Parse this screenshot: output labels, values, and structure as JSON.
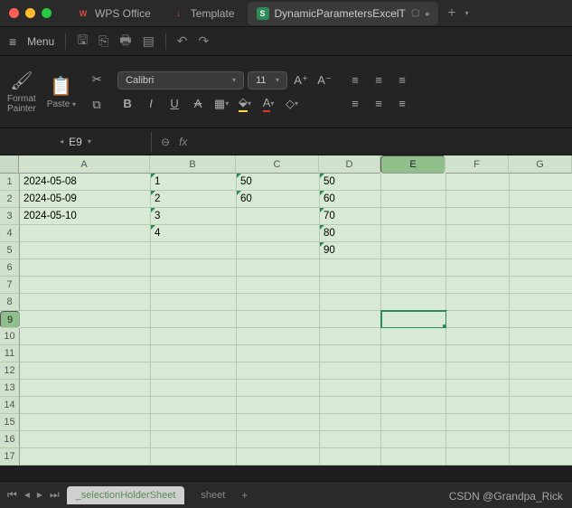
{
  "window": {
    "tabs": [
      {
        "icon": "W",
        "label": "WPS Office"
      },
      {
        "icon": "↓",
        "label": "Template"
      },
      {
        "icon": "S",
        "label": "DynamicParametersExcelT"
      }
    ],
    "menu_label": "Menu"
  },
  "ribbon": {
    "format_painter": "Format\nPainter",
    "paste": "Paste",
    "font_name": "Calibri",
    "font_size": "11"
  },
  "namebox": {
    "cell_ref": "E9",
    "fx": "fx"
  },
  "columns": [
    "A",
    "B",
    "C",
    "D",
    "E",
    "F",
    "G"
  ],
  "col_widths": [
    "c-a",
    "c-b",
    "c-c",
    "c-d",
    "c-e",
    "c-f",
    "c-g"
  ],
  "row_count": 17,
  "selected_col_idx": 4,
  "selected_row_idx": 8,
  "data": {
    "0": {
      "0": "2024-05-08",
      "1": "1",
      "2": "50",
      "3": "50"
    },
    "1": {
      "0": "2024-05-09",
      "1": "2",
      "2": "60",
      "3": "60"
    },
    "2": {
      "0": "2024-05-10",
      "1": "3",
      "3": "70"
    },
    "3": {
      "1": "4",
      "3": "80"
    },
    "4": {
      "3": "90"
    }
  },
  "marks": {
    "0": {
      "1": true,
      "2": true,
      "3": true
    },
    "1": {
      "1": true,
      "2": true,
      "3": true
    },
    "2": {
      "1": true,
      "3": true
    },
    "3": {
      "1": true,
      "3": true
    },
    "4": {
      "3": true
    }
  },
  "sheetbar": {
    "active_sheet": "_selectionHolderSheet",
    "other_sheet": "sheet"
  },
  "watermark": "CSDN @Grandpa_Rick"
}
